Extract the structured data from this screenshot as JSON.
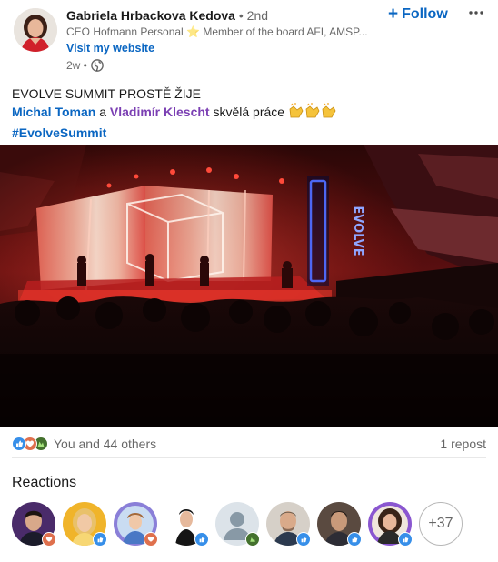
{
  "author": {
    "name": "Gabriela Hrbackova Kedova",
    "degree": "• 2nd",
    "headline": "CEO Hofmann Personal ⭐ Member of the board AFI, AMSP...",
    "website_link": "Visit my website",
    "time_ago": "2w •",
    "visibility_icon": "globe-icon"
  },
  "actions": {
    "follow_label": "Follow",
    "follow_icon": "plus-icon",
    "more_icon": "ellipsis-icon"
  },
  "post": {
    "line1": "EVOLVE SUMMIT PROSTĚ ŽIJE",
    "mention1": "Michal Toman",
    "connector": "a",
    "mention2": "Vladimír Klescht",
    "line2_tail": "skvělá práce",
    "emoji": "clapping-hands-icon x3",
    "hashtag": "#EvolveSummit"
  },
  "video": {
    "sign_text": "EVOLVE"
  },
  "social": {
    "reaction_icons": [
      "like-icon",
      "love-icon",
      "insightful-icon"
    ],
    "reactions_text": "You and 44 others",
    "reposts_text": "1 repost"
  },
  "reactions": {
    "title": "Reactions",
    "more_count": "+37"
  },
  "colors": {
    "link_blue": "#0a66c2",
    "mention_purple": "#7b3fb3",
    "like_blue": "#378fe9",
    "love_red": "#df704d",
    "celebrate_green": "#44712e"
  }
}
